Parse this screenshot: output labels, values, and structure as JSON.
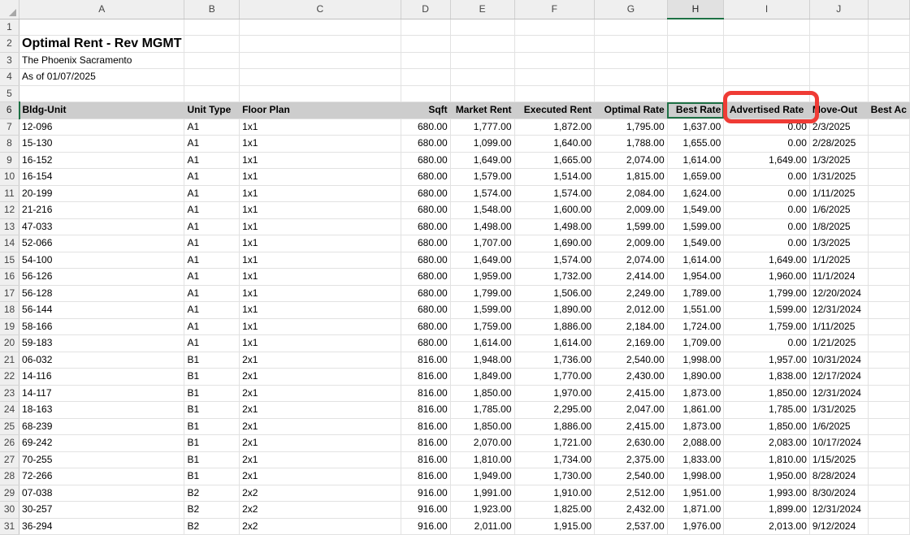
{
  "columns": [
    "A",
    "B",
    "C",
    "D",
    "E",
    "F",
    "G",
    "H",
    "I",
    "J",
    ""
  ],
  "rows": [
    {
      "n": "1",
      "cells": [
        "",
        "",
        "",
        "",
        "",
        "",
        "",
        "",
        "",
        "",
        ""
      ]
    },
    {
      "n": "2",
      "cells": [
        "Optimal Rent - Rev MGMT",
        "",
        "",
        "",
        "",
        "",
        "",
        "",
        "",
        "",
        ""
      ]
    },
    {
      "n": "3",
      "cells": [
        "The Phoenix Sacramento",
        "",
        "",
        "",
        "",
        "",
        "",
        "",
        "",
        "",
        ""
      ]
    },
    {
      "n": "4",
      "cells": [
        "As of 01/07/2025",
        "",
        "",
        "",
        "",
        "",
        "",
        "",
        "",
        "",
        ""
      ]
    },
    {
      "n": "5",
      "cells": [
        "",
        "",
        "",
        "",
        "",
        "",
        "",
        "",
        "",
        "",
        ""
      ]
    },
    {
      "n": "6",
      "cells": [
        "Bldg-Unit",
        "Unit Type",
        "Floor Plan",
        "Sqft",
        "Market Rent",
        "Executed Rent",
        "Optimal Rate",
        "Best Rate",
        "Advertised Rate",
        "Move-Out",
        "Best Ac"
      ]
    },
    {
      "n": "7",
      "cells": [
        "12-096",
        "A1",
        "1x1",
        "680.00",
        "1,777.00",
        "1,872.00",
        "1,795.00",
        "1,637.00",
        "0.00",
        "2/3/2025",
        ""
      ]
    },
    {
      "n": "8",
      "cells": [
        "15-130",
        "A1",
        "1x1",
        "680.00",
        "1,099.00",
        "1,640.00",
        "1,788.00",
        "1,655.00",
        "0.00",
        "2/28/2025",
        ""
      ]
    },
    {
      "n": "9",
      "cells": [
        "16-152",
        "A1",
        "1x1",
        "680.00",
        "1,649.00",
        "1,665.00",
        "2,074.00",
        "1,614.00",
        "1,649.00",
        "1/3/2025",
        ""
      ]
    },
    {
      "n": "10",
      "cells": [
        "16-154",
        "A1",
        "1x1",
        "680.00",
        "1,579.00",
        "1,514.00",
        "1,815.00",
        "1,659.00",
        "0.00",
        "1/31/2025",
        ""
      ]
    },
    {
      "n": "11",
      "cells": [
        "20-199",
        "A1",
        "1x1",
        "680.00",
        "1,574.00",
        "1,574.00",
        "2,084.00",
        "1,624.00",
        "0.00",
        "1/11/2025",
        ""
      ]
    },
    {
      "n": "12",
      "cells": [
        "21-216",
        "A1",
        "1x1",
        "680.00",
        "1,548.00",
        "1,600.00",
        "2,009.00",
        "1,549.00",
        "0.00",
        "1/6/2025",
        ""
      ]
    },
    {
      "n": "13",
      "cells": [
        "47-033",
        "A1",
        "1x1",
        "680.00",
        "1,498.00",
        "1,498.00",
        "1,599.00",
        "1,599.00",
        "0.00",
        "1/8/2025",
        ""
      ]
    },
    {
      "n": "14",
      "cells": [
        "52-066",
        "A1",
        "1x1",
        "680.00",
        "1,707.00",
        "1,690.00",
        "2,009.00",
        "1,549.00",
        "0.00",
        "1/3/2025",
        ""
      ]
    },
    {
      "n": "15",
      "cells": [
        "54-100",
        "A1",
        "1x1",
        "680.00",
        "1,649.00",
        "1,574.00",
        "2,074.00",
        "1,614.00",
        "1,649.00",
        "1/1/2025",
        ""
      ]
    },
    {
      "n": "16",
      "cells": [
        "56-126",
        "A1",
        "1x1",
        "680.00",
        "1,959.00",
        "1,732.00",
        "2,414.00",
        "1,954.00",
        "1,960.00",
        "11/1/2024",
        ""
      ]
    },
    {
      "n": "17",
      "cells": [
        "56-128",
        "A1",
        "1x1",
        "680.00",
        "1,799.00",
        "1,506.00",
        "2,249.00",
        "1,789.00",
        "1,799.00",
        "12/20/2024",
        ""
      ]
    },
    {
      "n": "18",
      "cells": [
        "56-144",
        "A1",
        "1x1",
        "680.00",
        "1,599.00",
        "1,890.00",
        "2,012.00",
        "1,551.00",
        "1,599.00",
        "12/31/2024",
        ""
      ]
    },
    {
      "n": "19",
      "cells": [
        "58-166",
        "A1",
        "1x1",
        "680.00",
        "1,759.00",
        "1,886.00",
        "2,184.00",
        "1,724.00",
        "1,759.00",
        "1/11/2025",
        ""
      ]
    },
    {
      "n": "20",
      "cells": [
        "59-183",
        "A1",
        "1x1",
        "680.00",
        "1,614.00",
        "1,614.00",
        "2,169.00",
        "1,709.00",
        "0.00",
        "1/21/2025",
        ""
      ]
    },
    {
      "n": "21",
      "cells": [
        "06-032",
        "B1",
        "2x1",
        "816.00",
        "1,948.00",
        "1,736.00",
        "2,540.00",
        "1,998.00",
        "1,957.00",
        "10/31/2024",
        ""
      ]
    },
    {
      "n": "22",
      "cells": [
        "14-116",
        "B1",
        "2x1",
        "816.00",
        "1,849.00",
        "1,770.00",
        "2,430.00",
        "1,890.00",
        "1,838.00",
        "12/17/2024",
        ""
      ]
    },
    {
      "n": "23",
      "cells": [
        "14-117",
        "B1",
        "2x1",
        "816.00",
        "1,850.00",
        "1,970.00",
        "2,415.00",
        "1,873.00",
        "1,850.00",
        "12/31/2024",
        ""
      ]
    },
    {
      "n": "24",
      "cells": [
        "18-163",
        "B1",
        "2x1",
        "816.00",
        "1,785.00",
        "2,295.00",
        "2,047.00",
        "1,861.00",
        "1,785.00",
        "1/31/2025",
        ""
      ]
    },
    {
      "n": "25",
      "cells": [
        "68-239",
        "B1",
        "2x1",
        "816.00",
        "1,850.00",
        "1,886.00",
        "2,415.00",
        "1,873.00",
        "1,850.00",
        "1/6/2025",
        ""
      ]
    },
    {
      "n": "26",
      "cells": [
        "69-242",
        "B1",
        "2x1",
        "816.00",
        "2,070.00",
        "1,721.00",
        "2,630.00",
        "2,088.00",
        "2,083.00",
        "10/17/2024",
        ""
      ]
    },
    {
      "n": "27",
      "cells": [
        "70-255",
        "B1",
        "2x1",
        "816.00",
        "1,810.00",
        "1,734.00",
        "2,375.00",
        "1,833.00",
        "1,810.00",
        "1/15/2025",
        ""
      ]
    },
    {
      "n": "28",
      "cells": [
        "72-266",
        "B1",
        "2x1",
        "816.00",
        "1,949.00",
        "1,730.00",
        "2,540.00",
        "1,998.00",
        "1,950.00",
        "8/28/2024",
        ""
      ]
    },
    {
      "n": "29",
      "cells": [
        "07-038",
        "B2",
        "2x2",
        "916.00",
        "1,991.00",
        "1,910.00",
        "2,512.00",
        "1,951.00",
        "1,993.00",
        "8/30/2024",
        ""
      ]
    },
    {
      "n": "30",
      "cells": [
        "30-257",
        "B2",
        "2x2",
        "916.00",
        "1,923.00",
        "1,825.00",
        "2,432.00",
        "1,871.00",
        "1,899.00",
        "12/31/2024",
        ""
      ]
    },
    {
      "n": "31",
      "cells": [
        "36-294",
        "B2",
        "2x2",
        "916.00",
        "2,011.00",
        "1,915.00",
        "2,537.00",
        "1,976.00",
        "2,013.00",
        "9/12/2024",
        ""
      ]
    }
  ],
  "colors": {
    "selection": "#1e7145",
    "header_fill": "#cdcdcd",
    "callout": "#ef3b35"
  }
}
